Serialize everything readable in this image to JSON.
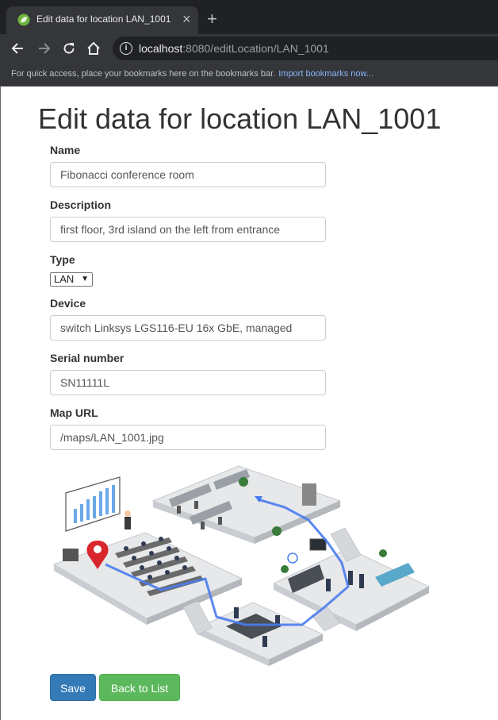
{
  "browser": {
    "tab_title": "Edit data for location LAN_1001",
    "tab_close": "×",
    "new_tab": "+",
    "url_host": "localhost",
    "url_rest": ":8080/editLocation/LAN_1001",
    "bookmarks_message": "For quick access, place your bookmarks here on the bookmarks bar.",
    "bookmarks_link": "Import bookmarks now..."
  },
  "page": {
    "title": "Edit data for location LAN_1001"
  },
  "form": {
    "name_label": "Name",
    "name_value": "Fibonacci conference room",
    "description_label": "Description",
    "description_value": "first floor, 3rd island on the left from entrance",
    "type_label": "Type",
    "type_value": "LAN",
    "device_label": "Device",
    "device_value": "switch Linksys LGS116-EU 16x GbE, managed",
    "serial_label": "Serial number",
    "serial_value": "SN11111L",
    "map_label": "Map URL",
    "map_value": "/maps/LAN_1001.jpg"
  },
  "buttons": {
    "save": "Save",
    "back": "Back to List"
  },
  "colors": {
    "primary": "#337ab7",
    "success": "#5cb85c",
    "route": "#4a7cf0",
    "pin": "#d9262c"
  }
}
